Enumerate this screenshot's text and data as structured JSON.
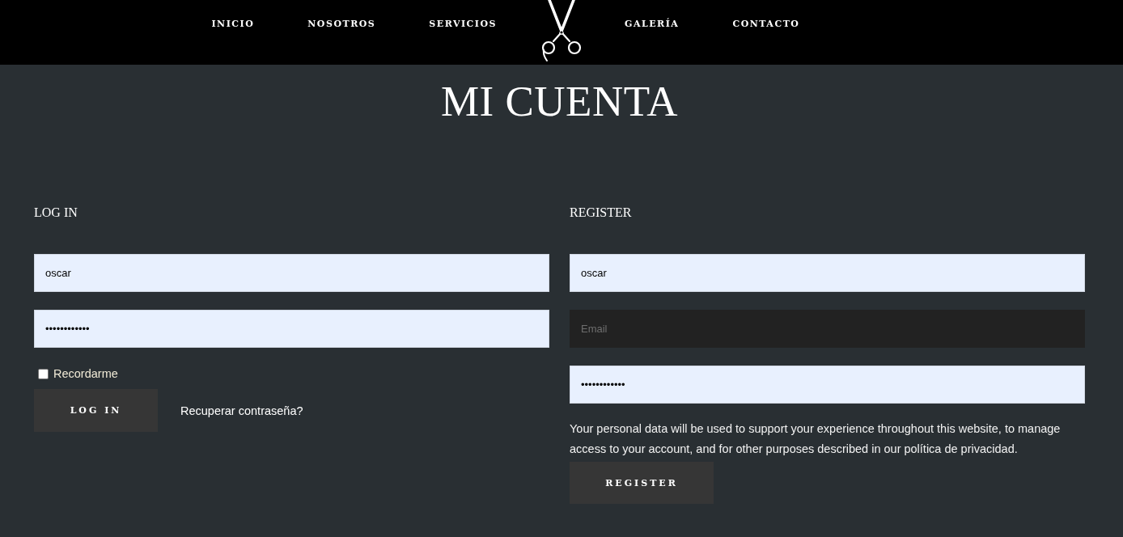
{
  "nav": {
    "left_items": [
      {
        "label": "INICIO"
      },
      {
        "label": "NOSOTROS"
      },
      {
        "label": "SERVICIOS"
      }
    ],
    "right_items": [
      {
        "label": "GALERÍA"
      },
      {
        "label": "CONTACTO"
      }
    ]
  },
  "page_title": "MI CUENTA",
  "login": {
    "heading": "LOG IN",
    "username": {
      "value": "oscar",
      "autofilled": true
    },
    "password": {
      "value": "••••••••••••",
      "autofilled": true
    },
    "remember": {
      "label": "Recordarme",
      "checked": false
    },
    "button": "LOG IN",
    "link": "Recuperar contraseña?"
  },
  "register": {
    "heading": "REGISTER",
    "username": {
      "value": "oscar",
      "autofilled": true
    },
    "email": {
      "placeholder": "Email",
      "autofilled": false
    },
    "password": {
      "value": "••••••••••••",
      "autofilled": true
    },
    "notice": "Your personal data will be used to support your experience throughout this website, to manage access to your account, and for other purposes described in our política de privacidad.",
    "button": "REGISTER"
  }
}
